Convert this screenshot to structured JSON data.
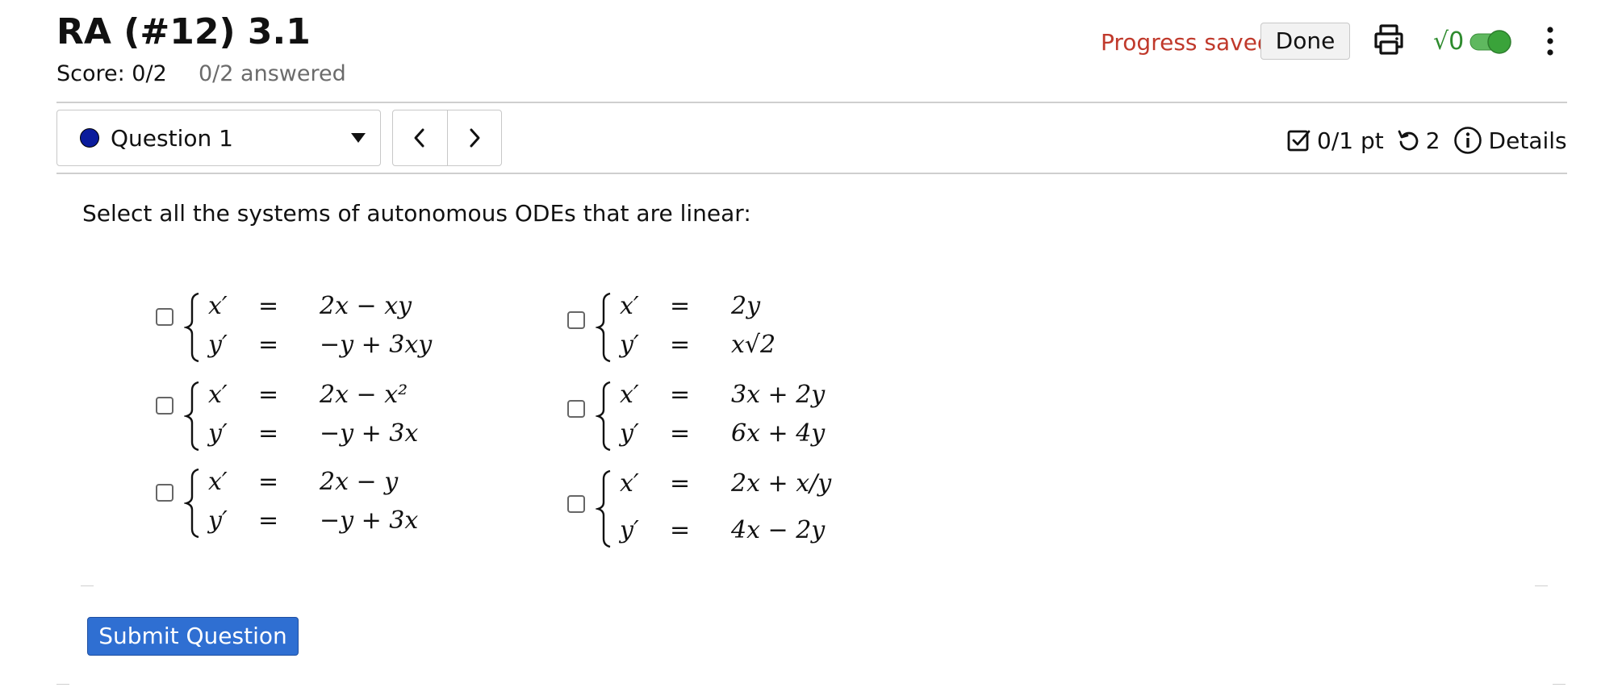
{
  "header": {
    "title": "RA (#12) 3.1",
    "score": "Score: 0/2",
    "answered": "0/2 answered",
    "progress_status": "Progress saved",
    "done_label": "Done",
    "icons": [
      "printer-icon",
      "math-toggle-icon",
      "more-vertical-icon"
    ],
    "math_toggle_label": "√0",
    "math_toggle_on": true,
    "progress_color": "#c0392b",
    "toggle_color": "#3aa33a"
  },
  "question_nav": {
    "selected": "Question 1",
    "status_color": "#0b1c9c",
    "points": "0/1 pt",
    "attempts": "2",
    "details_label": "Details"
  },
  "question": {
    "prompt": "Select all the systems of autonomous ODEs that are linear:",
    "choices": [
      {
        "x_lhs": "x′",
        "x_rhs": "2x − xy",
        "y_lhs": "y′",
        "y_rhs": "−y + 3xy",
        "checked": false
      },
      {
        "x_lhs": "x′",
        "x_rhs": "2y",
        "y_lhs": "y′",
        "y_rhs": "x√2",
        "checked": false
      },
      {
        "x_lhs": "x′",
        "x_rhs": "2x − x²",
        "y_lhs": "y′",
        "y_rhs": "−y + 3x",
        "checked": false
      },
      {
        "x_lhs": "x′",
        "x_rhs": "3x + 2y",
        "y_lhs": "y′",
        "y_rhs": "6x + 4y",
        "checked": false
      },
      {
        "x_lhs": "x′",
        "x_rhs": "2x − y",
        "y_lhs": "y′",
        "y_rhs": "−y + 3x",
        "checked": false
      },
      {
        "x_lhs": "x′",
        "x_rhs": "2x + x/y",
        "y_lhs": "y′",
        "y_rhs": "4x − 2y",
        "checked": false
      }
    ],
    "equals": "=",
    "submit_label": "Submit Question",
    "submit_color": "#2f6fd2"
  }
}
